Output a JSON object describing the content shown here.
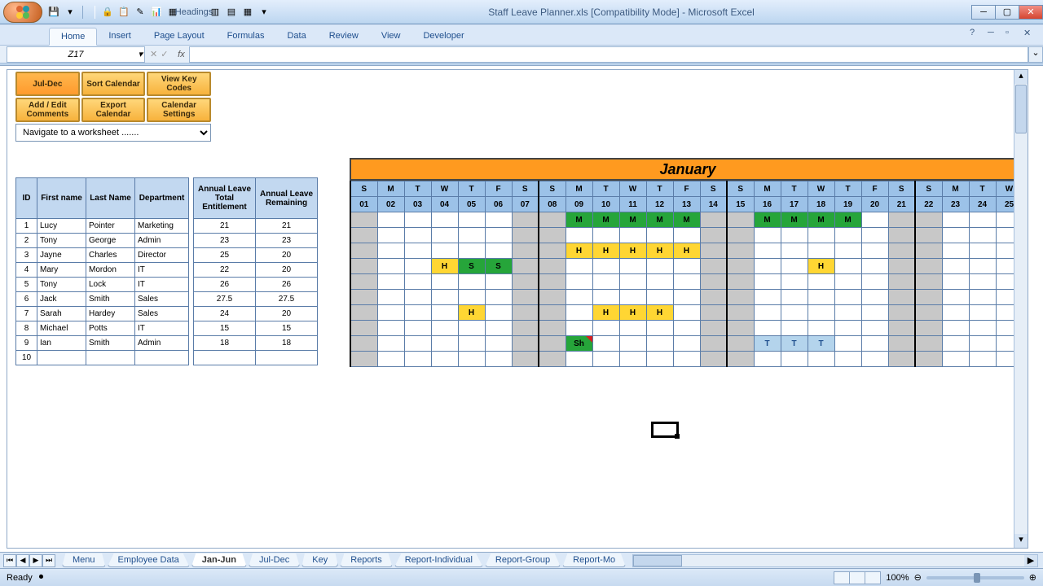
{
  "app": {
    "title": "Staff Leave Planner.xls  [Compatibility Mode] - Microsoft Excel"
  },
  "qat": {
    "style_label": "Headings"
  },
  "ribbon": {
    "tabs": [
      "Home",
      "Insert",
      "Page Layout",
      "Formulas",
      "Data",
      "Review",
      "View",
      "Developer"
    ],
    "active": 0
  },
  "namebox": "Z17",
  "panel": {
    "btns": [
      [
        "Jul-Dec",
        "Sort Calendar",
        "View Key Codes"
      ],
      [
        "Add / Edit Comments",
        "Export Calendar",
        "Calendar Settings"
      ]
    ],
    "nav_placeholder": "Navigate to a worksheet ......."
  },
  "staff_headers": {
    "id": "ID",
    "first": "First name",
    "last": "Last Name",
    "dept": "Department",
    "ent": "Annual Leave Total Entitlement",
    "rem": "Annual Leave Remaining"
  },
  "staff": [
    {
      "id": 1,
      "first": "Lucy",
      "last": "Pointer",
      "dept": "Marketing",
      "ent": 21,
      "rem": 21
    },
    {
      "id": 2,
      "first": "Tony",
      "last": "George",
      "dept": "Admin",
      "ent": 23,
      "rem": 23
    },
    {
      "id": 3,
      "first": "Jayne",
      "last": "Charles",
      "dept": "Director",
      "ent": 25,
      "rem": 20
    },
    {
      "id": 4,
      "first": "Mary",
      "last": "Mordon",
      "dept": "IT",
      "ent": 22,
      "rem": 20
    },
    {
      "id": 5,
      "first": "Tony",
      "last": "Lock",
      "dept": "IT",
      "ent": 26,
      "rem": 26
    },
    {
      "id": 6,
      "first": "Jack",
      "last": "Smith",
      "dept": "Sales",
      "ent": 27.5,
      "rem": 27.5
    },
    {
      "id": 7,
      "first": "Sarah",
      "last": "Hardey",
      "dept": "Sales",
      "ent": 24,
      "rem": 20
    },
    {
      "id": 8,
      "first": "Michael",
      "last": "Potts",
      "dept": "IT",
      "ent": 15,
      "rem": 15
    },
    {
      "id": 9,
      "first": "Ian",
      "last": "Smith",
      "dept": "Admin",
      "ent": 18,
      "rem": 18
    },
    {
      "id": 10,
      "first": "",
      "last": "",
      "dept": "",
      "ent": "",
      "rem": ""
    }
  ],
  "calendar": {
    "month": "January",
    "dow": [
      "S",
      "M",
      "T",
      "W",
      "T",
      "F",
      "S",
      "S",
      "M",
      "T",
      "W",
      "T",
      "F",
      "S",
      "S",
      "M",
      "T",
      "W",
      "T",
      "F",
      "S",
      "S",
      "M",
      "T",
      "W"
    ],
    "nums": [
      "01",
      "02",
      "03",
      "04",
      "05",
      "06",
      "07",
      "08",
      "09",
      "10",
      "11",
      "12",
      "13",
      "14",
      "15",
      "16",
      "17",
      "18",
      "19",
      "20",
      "21",
      "22",
      "23",
      "24",
      "25"
    ],
    "week_starts": [
      0,
      7,
      14,
      21
    ],
    "weekend_cols": [
      0,
      6,
      7,
      13,
      14,
      20,
      21
    ],
    "rows": [
      {
        "cells": {
          "8": "M",
          "9": "M",
          "10": "M",
          "11": "M",
          "12": "M",
          "15": "M",
          "16": "M",
          "17": "M",
          "18": "M"
        }
      },
      {
        "cells": {}
      },
      {
        "cells": {
          "8": "H",
          "9": "H",
          "10": "H",
          "11": "H",
          "12": "H"
        }
      },
      {
        "cells": {
          "3": "H",
          "4": "S",
          "5": "S",
          "17": "H"
        }
      },
      {
        "cells": {}
      },
      {
        "cells": {}
      },
      {
        "cells": {
          "4": "H",
          "9": "H",
          "10": "H",
          "11": "H"
        }
      },
      {
        "cells": {}
      },
      {
        "cells": {
          "8": "Sh",
          "15": "T",
          "16": "T",
          "17": "T"
        }
      },
      {
        "cells": {}
      }
    ]
  },
  "sheets": [
    "Menu",
    "Employee Data",
    "Jan-Jun",
    "Jul-Dec",
    "Key",
    "Reports",
    "Report-Individual",
    "Report-Group",
    "Report-Mo"
  ],
  "active_sheet": 2,
  "status": {
    "ready": "Ready",
    "zoom": "100%"
  }
}
